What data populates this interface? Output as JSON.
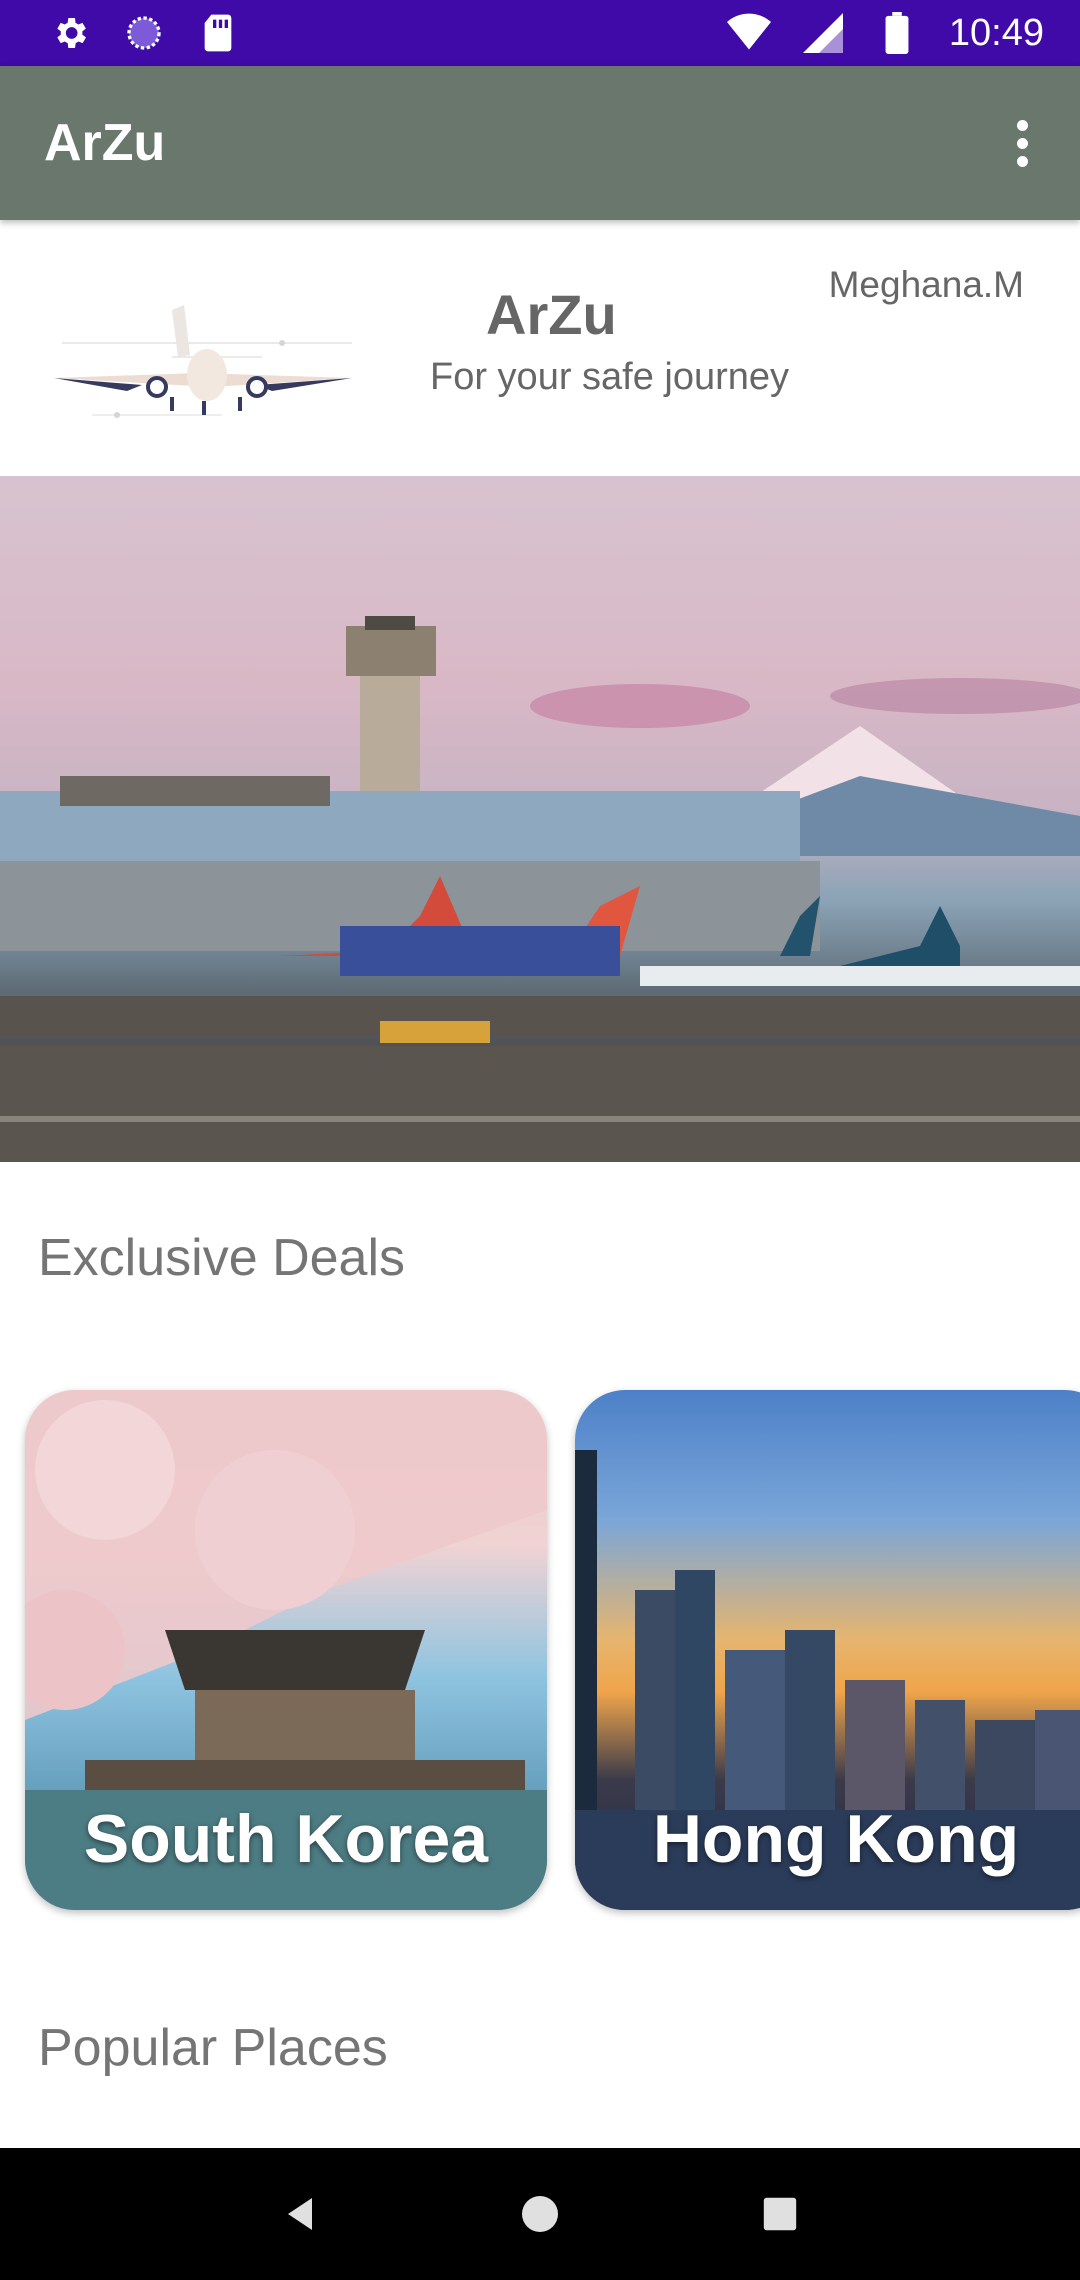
{
  "status_bar": {
    "time": "10:49",
    "left_icons": [
      "settings-icon",
      "sync-icon",
      "sd-card-icon"
    ],
    "right_icons": [
      "wifi-icon",
      "signal-icon",
      "battery-icon"
    ],
    "background": "#3f0aa8"
  },
  "app_bar": {
    "title": "ArZu",
    "overflow_icon": "more-vert-icon",
    "background": "#6a776d"
  },
  "header": {
    "brand": "ArZu",
    "tagline": "For your safe journey",
    "user": "Meghana.M",
    "logo_icon": "airplane-icon"
  },
  "hero": {
    "description_icon": "airport-photo"
  },
  "sections": {
    "deals_title": "Exclusive Deals",
    "popular_title": "Popular Places"
  },
  "deals": [
    {
      "label": "South Korea"
    },
    {
      "label": "Hong Kong"
    }
  ],
  "nav_bar": {
    "icons": [
      "back-icon",
      "home-icon",
      "recents-icon"
    ]
  }
}
